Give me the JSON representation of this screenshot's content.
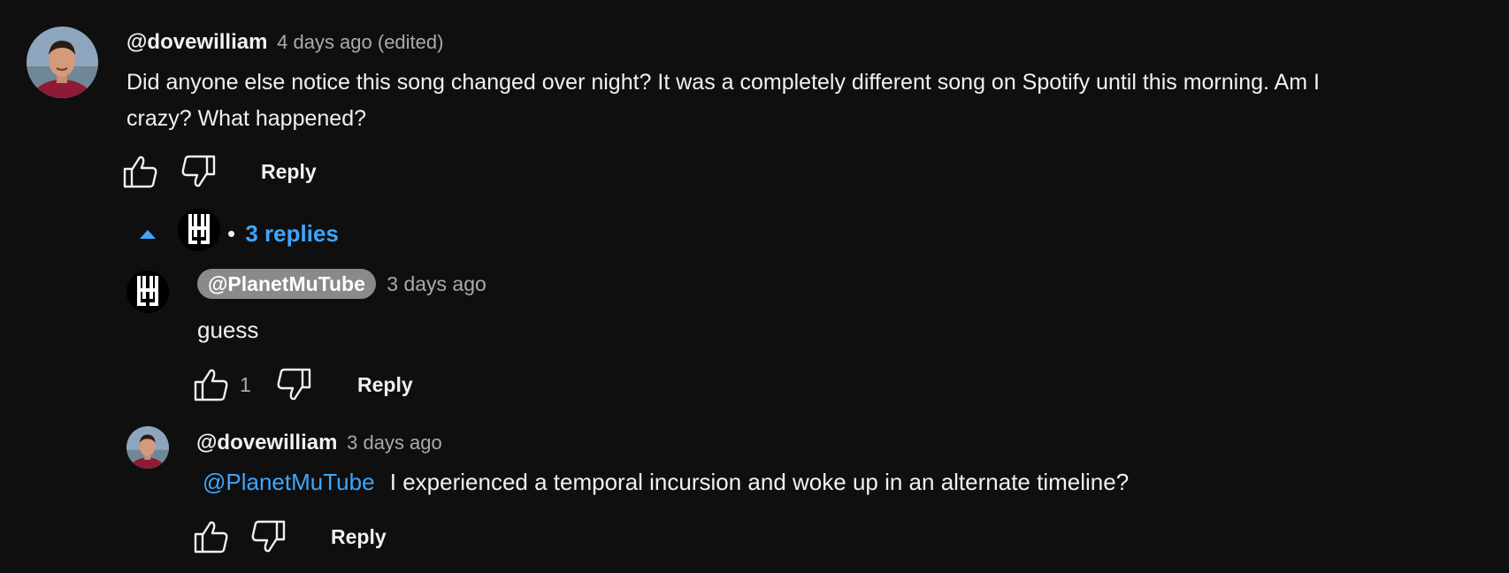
{
  "colors": {
    "background": "#0f0f0f",
    "text": "#f1f1f1",
    "muted": "#aaaaaa",
    "link": "#3ea6ff",
    "pill": "#8a8a8a"
  },
  "comment": {
    "author": "@dovewilliam",
    "time": "4 days ago (edited)",
    "text_line1": "Did anyone else notice this song changed over night? It was a completely different song on Spotify until this morning. Am I",
    "text_line2": "crazy? What happened?",
    "reply_label": "Reply",
    "like_icon": "thumbs-up-icon",
    "dislike_icon": "thumbs-down-icon"
  },
  "replies_toggle": {
    "bullet": "•",
    "label": "3 replies",
    "icon": "caret-up-icon"
  },
  "replies": [
    {
      "author": "@PlanetMuTube",
      "time": "3 days ago",
      "text": "guess",
      "like_count": "1",
      "reply_label": "Reply"
    },
    {
      "author": "@dovewilliam",
      "time": "3 days ago",
      "mention": "@PlanetMuTube",
      "text": "I experienced a temporal incursion and woke up in an alternate timeline?",
      "reply_label": "Reply"
    }
  ]
}
